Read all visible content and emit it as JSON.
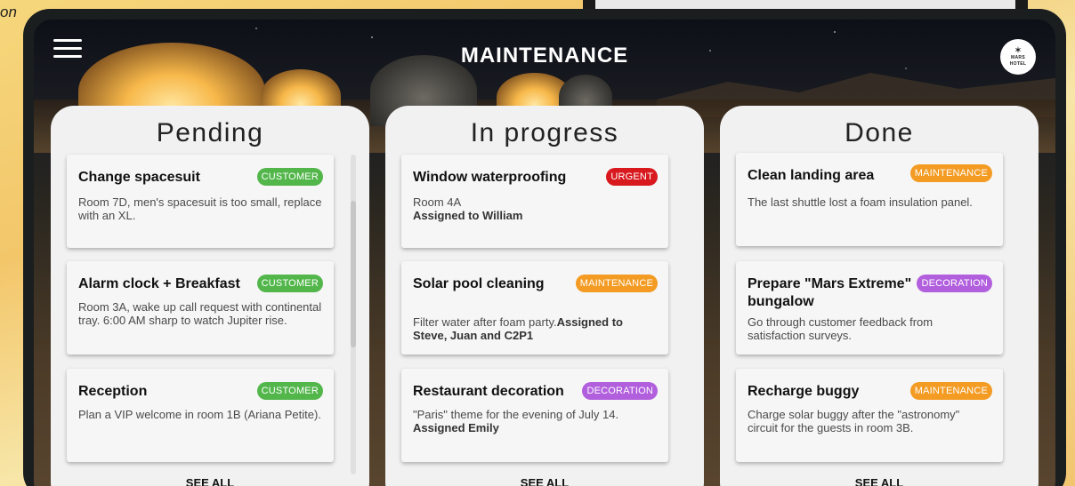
{
  "corner_fragment": "on",
  "header": {
    "title": "MAINTENANCE",
    "logo_text_line1": "MARS",
    "logo_text_line2": "HOTEL"
  },
  "icons": {
    "menu": "hamburger-menu-icon",
    "logo": "mars-hotel-logo"
  },
  "colors": {
    "customer": "#52b64b",
    "urgent": "#d8191e",
    "maintenance": "#f39b23",
    "decoration": "#b15fdd"
  },
  "columns": [
    {
      "title": "Pending",
      "see_all": "SEE ALL",
      "cards": [
        {
          "title": "Change spacesuit",
          "badge": "CUSTOMER",
          "desc": "Room 7D, men's spacesuit is too small, replace with an XL.",
          "assigned": ""
        },
        {
          "title": "Alarm clock + Breakfast",
          "badge": "CUSTOMER",
          "desc": "Room 3A, wake up call request with continental tray. 6:00 AM sharp to watch Jupiter rise.",
          "assigned": ""
        },
        {
          "title": "Reception",
          "badge": "CUSTOMER",
          "desc": "Plan a VIP welcome in room 1B (Ariana Petite).",
          "assigned": ""
        }
      ]
    },
    {
      "title": "In progress",
      "see_all": "SEE ALL",
      "cards": [
        {
          "title": "Window waterproofing",
          "badge": "URGENT",
          "desc": "Room 4A",
          "assigned": "Assigned to William"
        },
        {
          "title": "Solar pool cleaning",
          "badge": "MAINTENANCE",
          "desc": "Filter water after foam party.",
          "assigned": "Assigned to Steve, Juan and C2P1"
        },
        {
          "title": "Restaurant decoration",
          "badge": "DECORATION",
          "desc": "\"Paris\" theme for the evening of July 14.",
          "assigned": "Assigned Emily"
        }
      ]
    },
    {
      "title": "Done",
      "see_all": "SEE ALL",
      "cards": [
        {
          "title": "Clean landing area",
          "badge": "MAINTENANCE",
          "desc": "The last shuttle lost a foam insulation panel.",
          "assigned": ""
        },
        {
          "title": "Prepare \"Mars Extreme\" bungalow",
          "badge": "DECORATION",
          "desc": "Go through customer feedback from satisfaction surveys.",
          "assigned": ""
        },
        {
          "title": "Recharge buggy",
          "badge": "MAINTENANCE",
          "desc": "Charge solar buggy after the \"astronomy\" circuit for the guests in room 3B.",
          "assigned": ""
        }
      ]
    }
  ]
}
